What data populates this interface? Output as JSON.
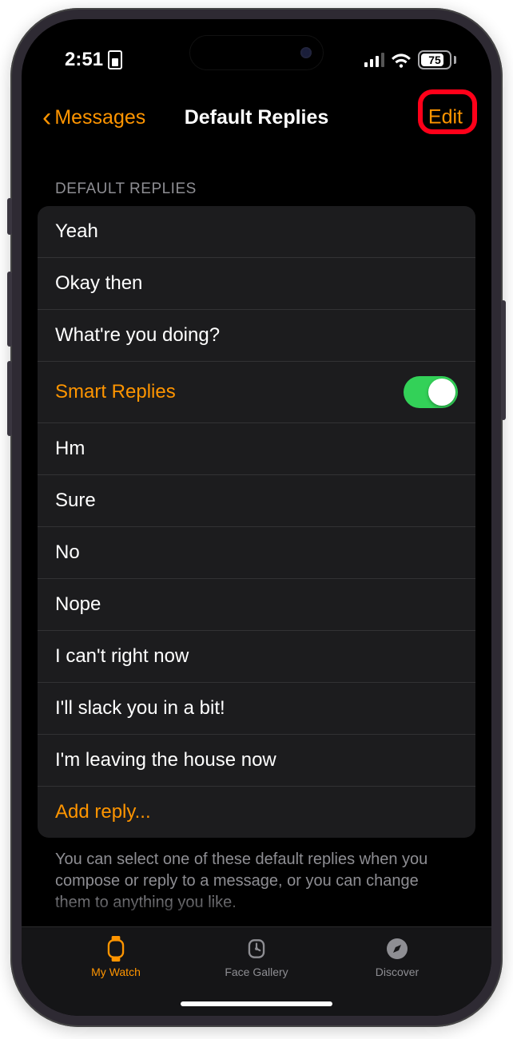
{
  "status": {
    "time": "2:51",
    "battery_pct": "75"
  },
  "nav": {
    "back_label": "Messages",
    "title": "Default Replies",
    "edit_label": "Edit"
  },
  "section": {
    "header": "DEFAULT REPLIES",
    "footer": "You can select one of these default replies when you compose or reply to a message, or you can change them to anything you like."
  },
  "replies": {
    "r0": "Yeah",
    "r1": "Okay then",
    "r2": "What're you doing?",
    "smart_label": "Smart Replies",
    "r3": "Hm",
    "r4": "Sure",
    "r5": "No",
    "r6": "Nope",
    "r7": "I can't right now",
    "r8": "I'll slack you in a bit!",
    "r9": "I'm leaving the house now",
    "add_label": "Add reply..."
  },
  "tabs": {
    "t0": "My Watch",
    "t1": "Face Gallery",
    "t2": "Discover"
  }
}
